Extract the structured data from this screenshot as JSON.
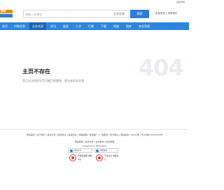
{
  "topbar": {
    "link": "会员登录"
  },
  "logo": {
    "text": "国际"
  },
  "search": {
    "placeholder": "请输入关键词",
    "type_label": "企业名录",
    "button_label": "搜索"
  },
  "header_links": "免费发布 | 采购询价",
  "nav": {
    "items": [
      {
        "label": "首页"
      },
      {
        "label": "供购信息"
      },
      {
        "label": "企业名录"
      },
      {
        "label": "资讯"
      },
      {
        "label": "展会"
      },
      {
        "label": "人才"
      },
      {
        "label": "行情"
      },
      {
        "label": "下载"
      },
      {
        "label": "知道"
      },
      {
        "label": "图库"
      },
      {
        "label": "商业导航"
      }
    ],
    "active_index": 2
  },
  "error": {
    "title": "主页不存在",
    "description": "您正在访问的主页可能已经删除、更名或尚未开通",
    "big_code": "404"
  },
  "footer": {
    "links": "网站首页 | 关于我们 | 联系方式 | 使用协议 | 版权隐私 | 网站地图 | 排名推广 | 广告服务 | 积分换礼 | 网站留言 | RSS订阅 | 粤ICP备XXXXXXXX号",
    "line2": "网站客服 | 技术支持 | 在线咨询 | 投诉举报",
    "line3": "Powered by DESTOON",
    "badges": [
      "经营许可",
      "网警备案"
    ],
    "certs": [
      "中国互联网 举报中心",
      "不良信息 举报中心"
    ]
  }
}
